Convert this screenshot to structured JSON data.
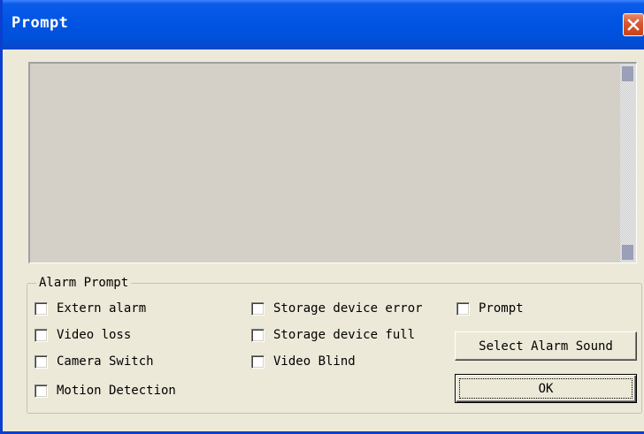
{
  "window": {
    "title": "Prompt"
  },
  "icons": {
    "close": "close-icon"
  },
  "group": {
    "label": "Alarm Prompt",
    "checkboxes": {
      "extern_alarm": "Extern alarm",
      "video_loss": "Video loss",
      "camera_switch": "Camera Switch",
      "motion_detection": "Motion Detection",
      "storage_device_error": "Storage device error",
      "storage_device_full": "Storage device full",
      "video_blind": "Video Blind",
      "prompt": "Prompt"
    },
    "checked": {
      "extern_alarm": false,
      "video_loss": false,
      "camera_switch": false,
      "motion_detection": false,
      "storage_device_error": false,
      "storage_device_full": false,
      "video_blind": false,
      "prompt": false
    }
  },
  "buttons": {
    "select_alarm_sound": "Select Alarm Sound",
    "ok": "OK"
  },
  "colors": {
    "titlebar": "#0054e3",
    "close_button": "#d8562f",
    "dialog_background": "#ece9d8",
    "log_background": "#d4d0c8",
    "scroll_thumb": "#9b9fb8"
  }
}
